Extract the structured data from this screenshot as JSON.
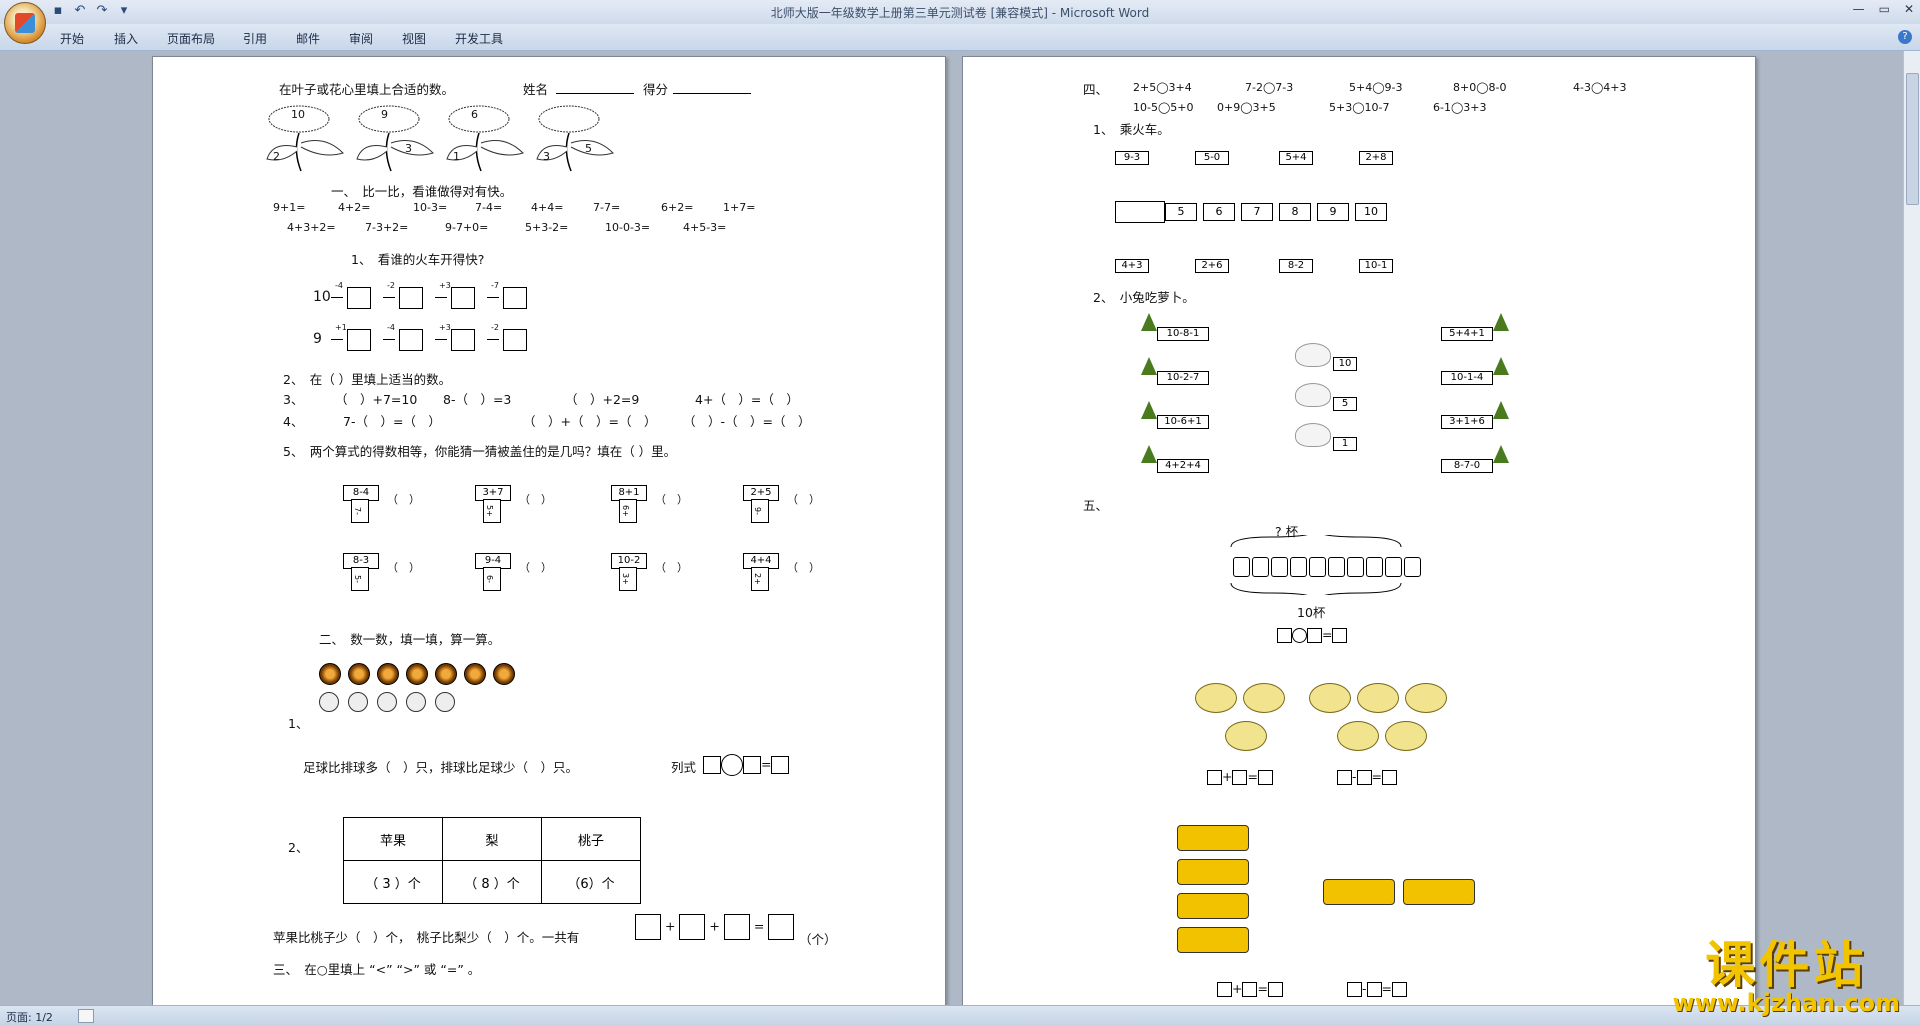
{
  "window": {
    "title": "北师大版一年级数学上册第三单元测试卷 [兼容模式] - Microsoft Word"
  },
  "ribbon": {
    "tabs": [
      "开始",
      "插入",
      "页面布局",
      "引用",
      "邮件",
      "审阅",
      "视图",
      "开发工具"
    ]
  },
  "status": {
    "page": "页面: 1/2"
  },
  "left_page": {
    "header": "在叶子或花心里填上合适的数。",
    "name_label": "姓名",
    "score_label": "得分",
    "flowers": [
      {
        "center": "10",
        "left": "2",
        "right": ""
      },
      {
        "center": "9",
        "left": "",
        "right": "3"
      },
      {
        "center": "6",
        "left": "1",
        "right": ""
      },
      {
        "center": "",
        "left": "3",
        "right": "5"
      }
    ],
    "s1_title": "一、　比一比，看谁做得对有快。",
    "row1": [
      "9+1=",
      "4+2=",
      "10-3=",
      "7-4=",
      "4+4=",
      "7-7=",
      "6+2=",
      "1+7="
    ],
    "row2": [
      "4+3+2=",
      "7-3+2=",
      "9-7+0=",
      "5+3-2=",
      "10-0-3=",
      "4+5-3="
    ],
    "q1": "1、　看谁的火车开得快?",
    "train1": {
      "start": "10",
      "ops": [
        "-4",
        "-2",
        "+3",
        "-7"
      ]
    },
    "train2": {
      "start": "9",
      "ops": [
        "+1",
        "-4",
        "+3",
        "-2"
      ]
    },
    "q2": "2、　在（  ）里填上适当的数。",
    "q3": [
      "3、",
      "（　）+7=10",
      "8-（　）=3",
      "（　）+2=9",
      "4+（　）=（　）"
    ],
    "q4": [
      "4、",
      "7-（　）=（　）",
      "（　）+（　）=（　）",
      "（　）-（　）=（　）"
    ],
    "q5": "5、　两个算式的得数相等，你能猜一猜被盖住的是几吗？填在（  ）里。",
    "cards_row1": [
      {
        "top": "8-4",
        "side": "7-"
      },
      {
        "top": "3+7",
        "side": "5+"
      },
      {
        "top": "8+1",
        "side": "6+"
      },
      {
        "top": "2+5",
        "side": "9-"
      }
    ],
    "cards_row2": [
      {
        "top": "8-3",
        "side": "5-"
      },
      {
        "top": "9-4",
        "side": "6-"
      },
      {
        "top": "10-2",
        "side": "3+"
      },
      {
        "top": "4+4",
        "side": "2+"
      }
    ],
    "paren": "（　）",
    "s2_title": "二、　数一数，填一填，算一算。",
    "num1": "1、",
    "compare_text": "足球比排球多（　）只，排球比足球少（　）只。",
    "formula_label": "列式",
    "num2": "2、",
    "table_head": [
      "苹果",
      "梨",
      "桃子"
    ],
    "table_vals": [
      "（ 3 ）个",
      "（ 8 ）个",
      "（6）个"
    ],
    "apple_text": "苹果比桃子少（　）个，　桃子比梨少（　）个。一共有",
    "unit": "（个）",
    "s3_title": "三、　在○里填上 “<” “>” 或 “=” 。"
  },
  "right_page": {
    "s4_label": "四、",
    "s4_row1": [
      "2+5◯3+4",
      "7-2◯7-3",
      "5+4◯9-3",
      "8+0◯8-0",
      "4-3◯4+3"
    ],
    "s4_row2": [
      "10-5◯5+0",
      "0+9◯3+5",
      "5+3◯10-7",
      "6-1◯3+3"
    ],
    "q1": "1、　乘火车。",
    "top_boxes": [
      "9-3",
      "5-0",
      "5+4",
      "2+8"
    ],
    "cars": [
      "5",
      "6",
      "7",
      "8",
      "9",
      "10"
    ],
    "bottom_boxes": [
      "4+3",
      "2+6",
      "8-2",
      "10-1"
    ],
    "q2": "2、　小兔吃萝卜。",
    "left_carrots": [
      "10-8-1",
      "10-2-7",
      "10-6+1",
      "4+2+4"
    ],
    "rabbit_nums": [
      "10",
      "5",
      "1"
    ],
    "right_carrots": [
      "5+4+1",
      "10-1-4",
      "3+1+6",
      "8-7-0"
    ],
    "s5_label": "五、",
    "cup_question": "? 杯",
    "cup_total": "10杯",
    "eq_add": "+",
    "eq_sub": "-",
    "eq_eq": "="
  },
  "watermark": {
    "line1": "课件站",
    "line2": "www.kjzhan.com"
  }
}
